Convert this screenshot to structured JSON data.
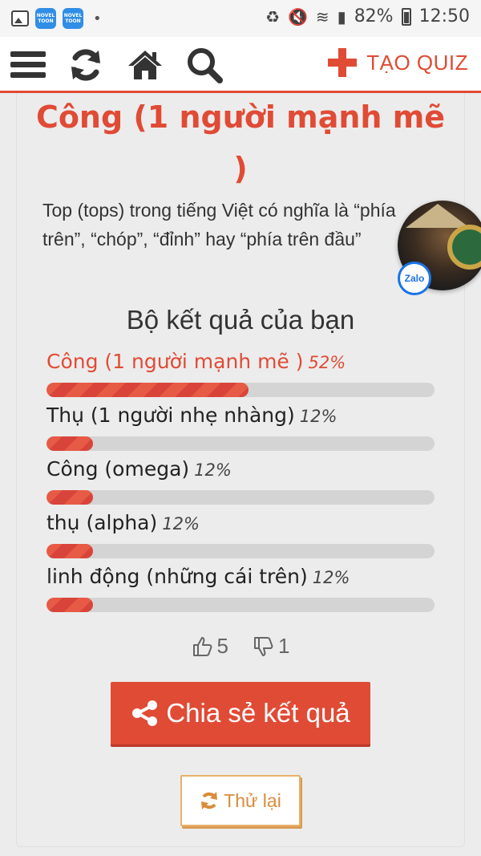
{
  "status_bar": {
    "app_badge_1": "NOVEL TOON",
    "app_badge_2": "NOVEL TOON",
    "battery": "82%",
    "time": "12:50"
  },
  "header": {
    "create_quiz_label": "TẠO QUIZ"
  },
  "result": {
    "title": "Công (1 người mạnh mẽ )",
    "description": "Top (tops) trong tiếng Việt có nghĩa là “phía trên”, “chóp”, “đỉnh” hay “phía trên đầu”",
    "set_heading": "Bộ kết quả của bạn",
    "items": [
      {
        "name": "Công (1 người mạnh mẽ )",
        "percent": "52%",
        "value": 52
      },
      {
        "name": "Thụ (1 người nhẹ nhàng)",
        "percent": "12%",
        "value": 12
      },
      {
        "name": "Công (omega)",
        "percent": "12%",
        "value": 12
      },
      {
        "name": "thụ (alpha)",
        "percent": "12%",
        "value": 12
      },
      {
        "name": "linh động (những cái trên)",
        "percent": "12%",
        "value": 12
      }
    ]
  },
  "votes": {
    "likes": "5",
    "dislikes": "1"
  },
  "actions": {
    "share_label": "Chia sẻ kết quả",
    "retry_label": "Thử lại"
  },
  "floating": {
    "zalo_label": "Zalo"
  },
  "colors": {
    "accent": "#e04b35",
    "retry": "#d98c3a"
  }
}
